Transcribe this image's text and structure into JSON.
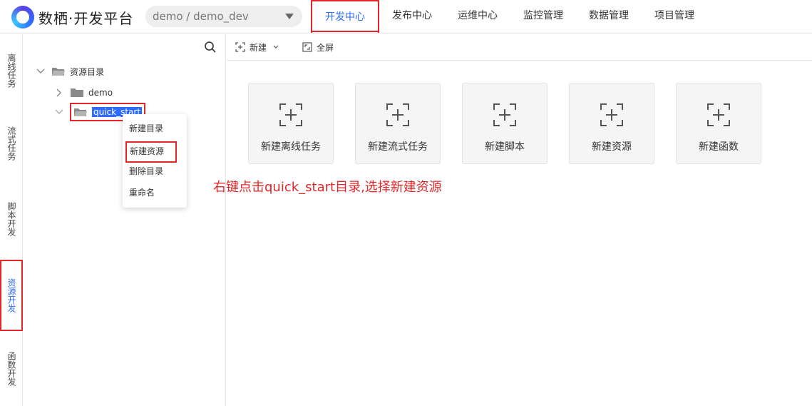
{
  "brand": {
    "name": "数栖·开发平台"
  },
  "project_select": {
    "value": "demo / demo_dev"
  },
  "nav": [
    {
      "label": "开发中心"
    },
    {
      "label": "发布中心"
    },
    {
      "label": "运维中心"
    },
    {
      "label": "监控管理"
    },
    {
      "label": "数据管理"
    },
    {
      "label": "项目管理"
    }
  ],
  "sidebar": [
    {
      "label": "离线任务"
    },
    {
      "label": "流式任务"
    },
    {
      "label": "脚本开发"
    },
    {
      "label": "资源开发"
    },
    {
      "label": "函数开发"
    }
  ],
  "tree": {
    "root": "资源目录",
    "children": [
      {
        "label": "demo"
      },
      {
        "label": "quick_start"
      }
    ]
  },
  "context_menu": [
    {
      "label": "新建目录"
    },
    {
      "label": "新建资源"
    },
    {
      "label": "删除目录"
    },
    {
      "label": "重命名"
    }
  ],
  "annotation": "右键点击quick_start目录,选择新建资源",
  "toolbar": {
    "new_label": "新建",
    "fullscreen_label": "全屏"
  },
  "cards": [
    {
      "label": "新建离线任务"
    },
    {
      "label": "新建流式任务"
    },
    {
      "label": "新建脚本"
    },
    {
      "label": "新建资源"
    },
    {
      "label": "新建函数"
    }
  ],
  "colors": {
    "accent": "#2f6bff",
    "annotation": "#e0282a"
  }
}
